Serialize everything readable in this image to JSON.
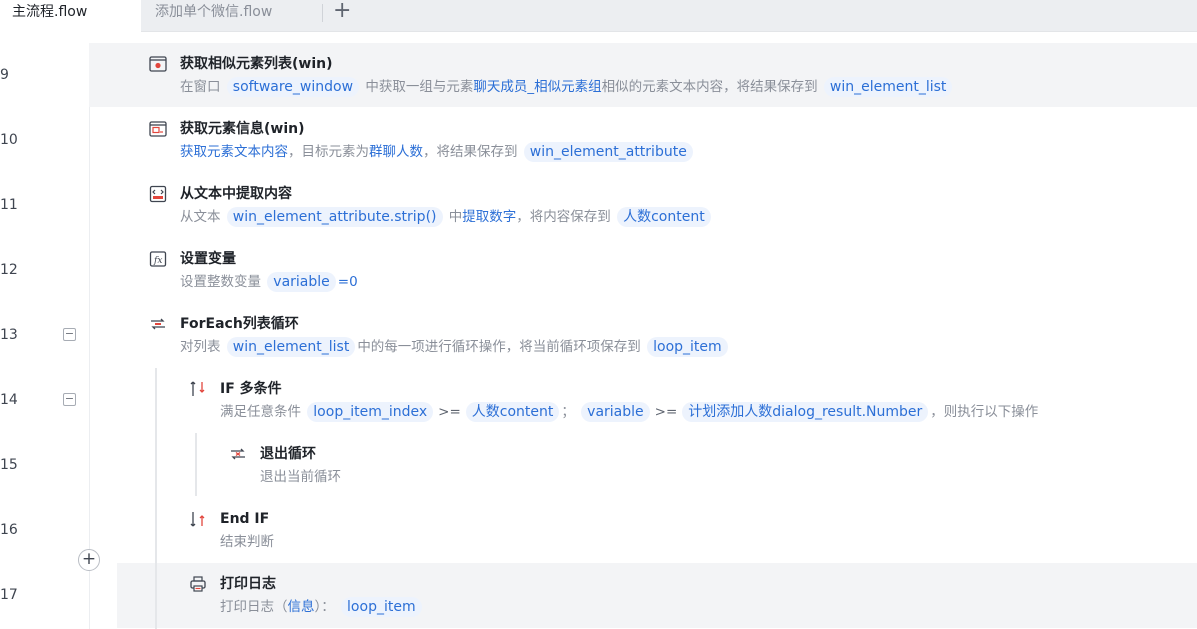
{
  "tabs": {
    "active": "主流程.flow",
    "inactive": "添加单个微信.flow",
    "add": "+"
  },
  "editor": {
    "add_step": "+",
    "rows": [
      {
        "line": "9",
        "title": "获取相似元素列表(win)",
        "d1": "在窗口",
        "t1": "software_window",
        "d2": "中获取一组与元素",
        "l1": "聊天成员_相似元素组",
        "d3": "相似的元素文本内容，将结果保存到",
        "t2": "win_element_list"
      },
      {
        "line": "10",
        "title": "获取元素信息(win)",
        "l1": "获取元素文本内容",
        "d1": "，目标元素为",
        "l2": "群聊人数",
        "d2": "，将结果保存到",
        "t1": "win_element_attribute"
      },
      {
        "line": "11",
        "title": "从文本中提取内容",
        "d1": "从文本",
        "t1": "win_element_attribute.strip()",
        "d2": "中",
        "l1": "提取数字",
        "d3": "，将内容保存到",
        "t2": "人数content"
      },
      {
        "line": "12",
        "title": "设置变量",
        "d1": "设置整数变量",
        "t1": "variable",
        "l1": "=0"
      },
      {
        "line": "13",
        "title": "ForEach列表循环",
        "d1": "对列表",
        "t1": "win_element_list",
        "d2": "中的每一项进行循环操作，将当前循环项保存到",
        "t2": "loop_item"
      },
      {
        "line": "14",
        "title": "IF 多条件",
        "d1": "满足任意条件",
        "t1": "loop_item_index",
        "o1": ">=",
        "t2": "人数content",
        "d2": "；",
        "t3": "variable",
        "o2": ">=",
        "t4": "计划添加人数dialog_result.Number",
        "d3": "，则执行以下操作"
      },
      {
        "line": "15",
        "title": "退出循环",
        "d1": "退出当前循环"
      },
      {
        "line": "16",
        "title": "End IF",
        "d1": "结束判断"
      },
      {
        "line": "17",
        "title": "打印日志",
        "d1": "打印日志（",
        "l1": "信息",
        "d2": "）：",
        "t1": "loop_item"
      }
    ]
  }
}
